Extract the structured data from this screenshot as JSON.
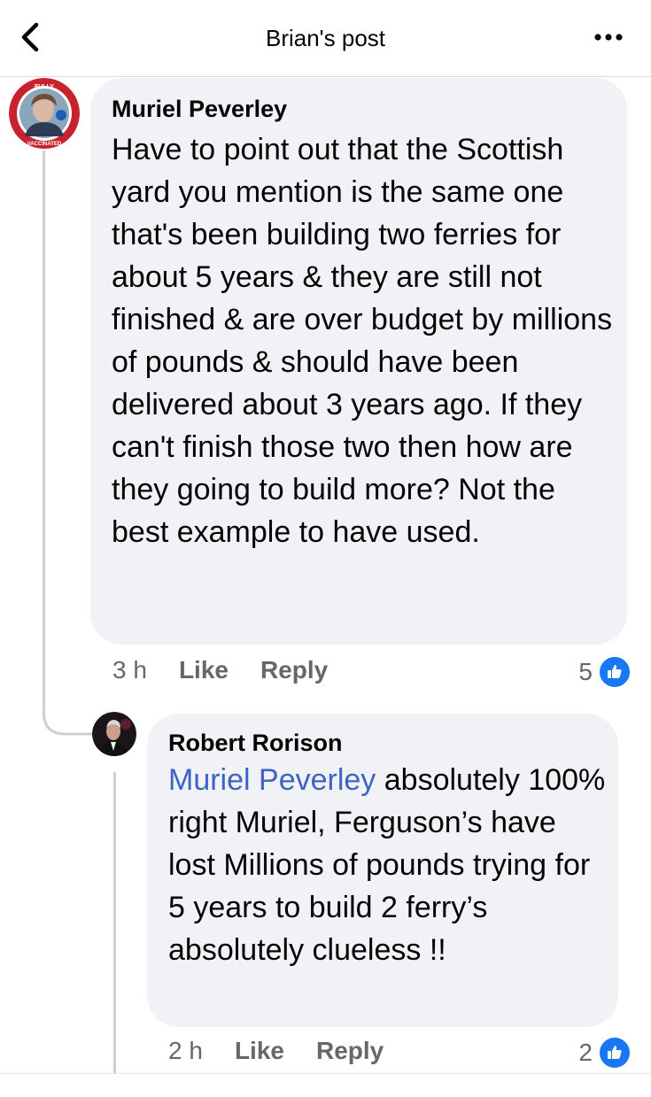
{
  "header": {
    "title": "Brian's post",
    "back_icon": "chevron-left-icon",
    "more_icon": "more-dots-icon"
  },
  "comments": [
    {
      "author": "Muriel Peverley",
      "avatar_badge_top": "FULLY",
      "avatar_badge_bottom": "VACCINATED",
      "text": "Have to point out that the Scottish yard you mention is the same one that's been building two ferries for about 5 years & they are still not finished & are over budget by millions of pounds & should have been delivered about 3 years ago. If they can't finish those two then how are they going to build more? Not the best example to have used.",
      "time": "3 h",
      "like_label": "Like",
      "reply_label": "Reply",
      "reaction_count": "5"
    },
    {
      "author": "Robert Rorison",
      "mention": "Muriel Peverley",
      "text": " absolutely 100% right Muriel, Ferguson’s have lost Millions of pounds trying for 5 years to build 2 ferry’s absolutely clueless !!",
      "time": "2 h",
      "like_label": "Like",
      "reply_label": "Reply",
      "reaction_count": "2"
    }
  ],
  "colors": {
    "accent": "#1877f2",
    "mention": "#3d63c4",
    "bubble": "#f0f2f5",
    "meta": "#65676b"
  }
}
